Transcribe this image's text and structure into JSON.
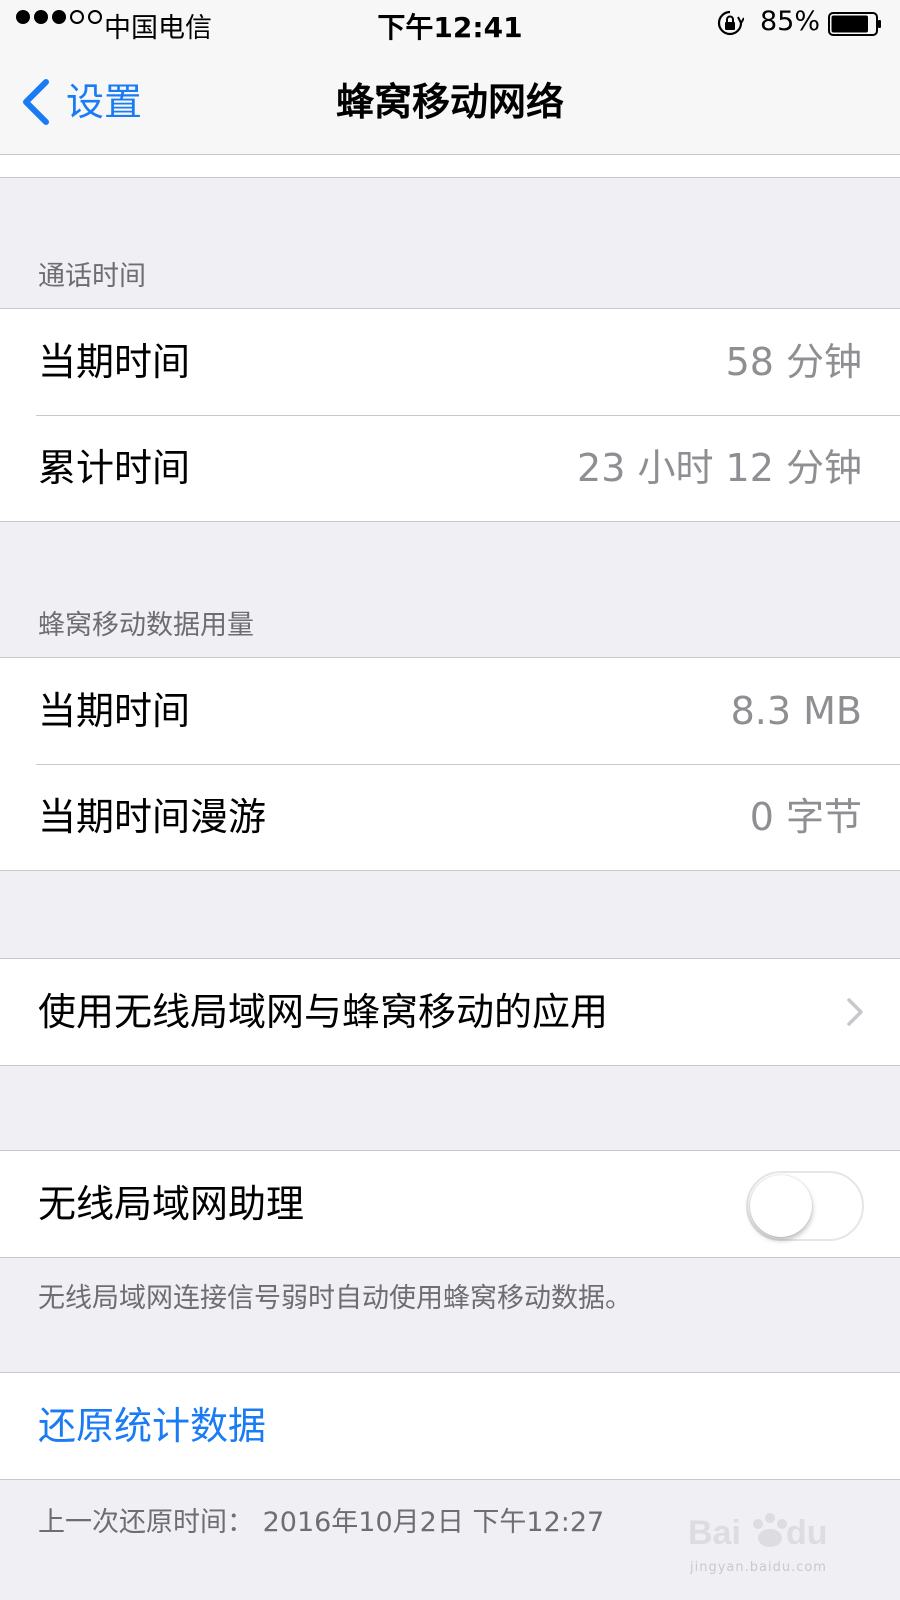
{
  "status_bar": {
    "carrier": "中国电信",
    "time": "下午12:41",
    "battery_percent": "85%",
    "battery_level": 0.85,
    "signal_bars_filled": 3,
    "signal_bars_total": 5
  },
  "nav": {
    "back_label": "设置",
    "title": "蜂窝移动网络"
  },
  "call_time": {
    "header": "通话时间",
    "rows": [
      {
        "label": "当期时间",
        "value": "58 分钟"
      },
      {
        "label": "累计时间",
        "value": "23 小时 12 分钟"
      }
    ]
  },
  "data_usage": {
    "header": "蜂窝移动数据用量",
    "rows": [
      {
        "label": "当期时间",
        "value": "8.3 MB"
      },
      {
        "label": "当期时间漫游",
        "value": "0 字节"
      }
    ]
  },
  "apps_row": {
    "label": "使用无线局域网与蜂窝移动的应用"
  },
  "wifi_assist": {
    "label": "无线局域网助理",
    "enabled": false,
    "footer": "无线局域网连接信号弱时自动使用蜂窝移动数据。"
  },
  "reset": {
    "label": "还原统计数据",
    "footer": "上一次还原时间：  2016年10月2日 下午12:27"
  },
  "watermark": {
    "url": "jingyan.baidu.com"
  },
  "colors": {
    "accent": "#1a7cf5",
    "background": "#efeff4",
    "secondary_text": "#8e8e93"
  },
  "icons": [
    "back-chevron-icon",
    "rotation-lock-icon",
    "battery-icon",
    "disclosure-chevron-icon"
  ]
}
